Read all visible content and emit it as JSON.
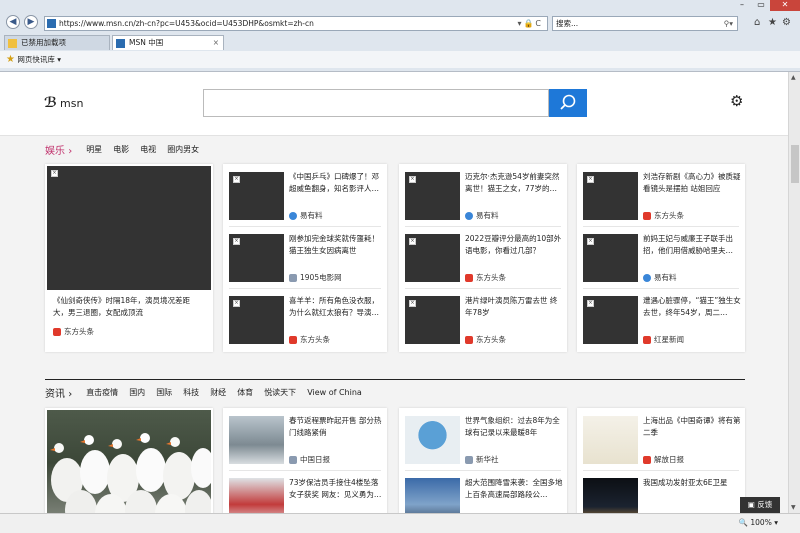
{
  "browser": {
    "address": "https://www.msn.cn/zh-cn?pc=U453&ocid=U453DHP&osmkt=zh-cn",
    "search_placeholder": "搜索...",
    "tabs": [
      {
        "label": "已禁用加载项"
      },
      {
        "label": "MSN 中国"
      }
    ],
    "favorites_label": "网页快讯库 ▾",
    "zoom": "100%"
  },
  "page": {
    "logo": "msn",
    "feedback": "反馈",
    "ent": {
      "title": "娱乐",
      "chevron": "›",
      "subnav": [
        "明星",
        "电影",
        "电视",
        "圈内男女"
      ],
      "big": {
        "title": "《仙剑奇侠传》时隔18年，演员境况差距大，男三退圈，女配成顶流",
        "source": "东方头条"
      },
      "col2": [
        {
          "title": "《中国乒乓》口碑爆了！邓超威鱼翻身，知名影评人…",
          "source": "易有料"
        },
        {
          "title": "刚参加完金球奖就传噩耗！猫王独生女因病离世",
          "source": "1905电影网"
        },
        {
          "title": "喜羊羊：所有角色没衣服，为什么就红太狼有？导演…",
          "source": "东方头条"
        }
      ],
      "col3": [
        {
          "title": "迈克尔·杰克逊54岁前妻突然离世！猫王之女，77岁的…",
          "source": "易有料"
        },
        {
          "title": "2022豆瓣评分最高的10部外语电影，你看过几部？",
          "source": "东方头条"
        },
        {
          "title": "港片绿叶演员陈万雷去世 终年78岁",
          "source": "东方头条"
        }
      ],
      "col4": [
        {
          "title": "刘浩存新剧《高心力》被质疑看镜头是摆拍 站姐回应",
          "source": "东方头条"
        },
        {
          "title": "前妈王妃与威廉王子联手出招，他们用借威胁哈里夫…",
          "source": "易有料"
        },
        {
          "title": "遭遇心脏骤停，“猫王”独生女去世，终年54岁，周二…",
          "source": "红星新闻"
        }
      ]
    },
    "news": {
      "title": "资讯",
      "chevron": "›",
      "subnav": [
        "直击疫情",
        "国内",
        "国际",
        "科技",
        "财经",
        "体育",
        "悦读天下",
        "View of China"
      ],
      "col2": [
        {
          "title": "春节返程票昨起开售 部分热门线路紧俏",
          "source": "中国日报"
        },
        {
          "title": "73岁保洁员手接住4楼坠落女子获奖 网友：见义勇为…",
          "source": ""
        }
      ],
      "col3": [
        {
          "title": "世界气象组织：过去8年为全球有记录以来最暖8年",
          "source": "新华社"
        },
        {
          "title": "超大范围降雪来袭：全国多地上百条高速局部路段公…",
          "source": ""
        }
      ],
      "col4": [
        {
          "title": "上海出品《中国奇谭》将有第二季",
          "source": "解放日报"
        },
        {
          "title": "我国成功发射亚太6E卫星",
          "source": ""
        }
      ]
    }
  }
}
